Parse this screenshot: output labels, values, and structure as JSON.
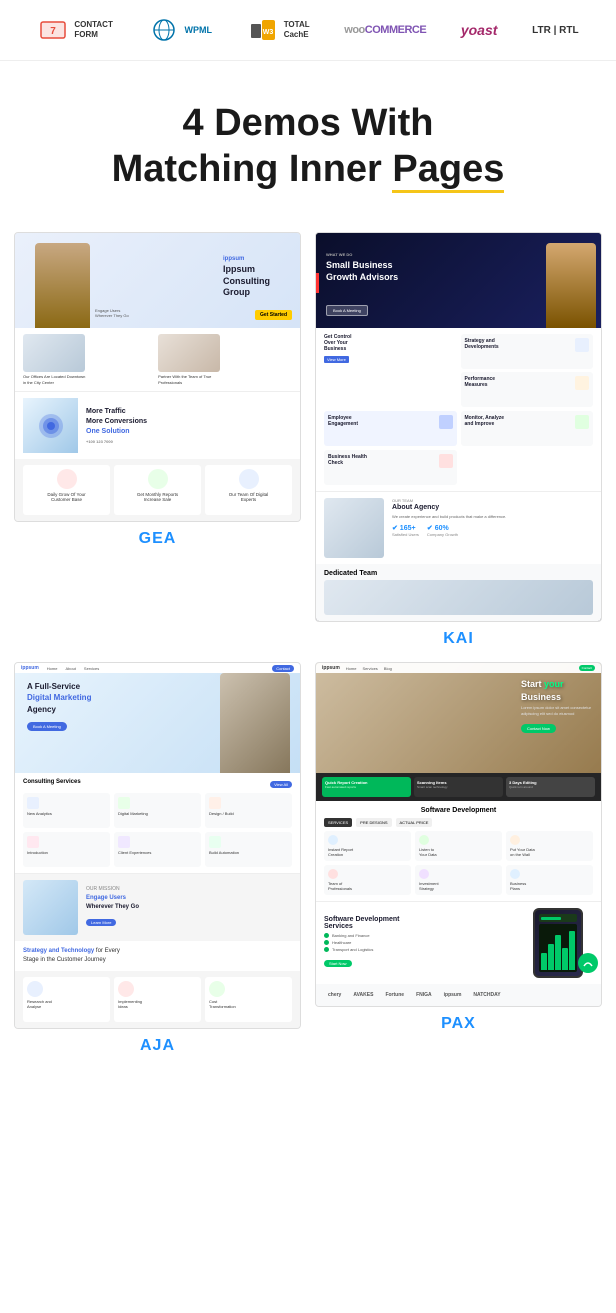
{
  "plugin_bar": {
    "plugins": [
      {
        "name": "contact-form-7",
        "label": "CONTACT\nFORM 7",
        "color": "#e74c3c"
      },
      {
        "name": "wpml",
        "label": "WPML",
        "color": "#0073aa"
      },
      {
        "name": "total-cache",
        "label": "TOTAL\nCACHE",
        "color": "#f0a500"
      },
      {
        "name": "woocommerce",
        "label": "WOO\nCOMMERCE",
        "color": "#7f54b3"
      },
      {
        "name": "yoast",
        "label": "yoast",
        "color": "#a4286a"
      },
      {
        "name": "ltr-rtl",
        "label": "LTR | RTL",
        "color": "#333"
      }
    ]
  },
  "hero": {
    "line1": "4 Demos With",
    "line2": "Matching Inner",
    "line2_underline": "Pages"
  },
  "demos": [
    {
      "id": "gea",
      "label": "GEA",
      "hero_text": "Ippsum\nConsulting\nGroup",
      "section2_left": "Our Offices Are Located Downtown\nin the City Center",
      "section2_right": "Partner With the Team of True\nProfessionals",
      "traffic_text": "More Traffic\nMore Conversions\nOne Solution",
      "bottom_items": [
        "Daily Grow Of Your\nCustomer Base",
        "Get Monthly Reports\nIncrease Sale",
        "Our Team Of Digital\nExperts"
      ]
    },
    {
      "id": "kai",
      "label": "KAI",
      "hero_text": "Small Business\nGrowth Advisors",
      "cards": [
        "Strategy and\nDevelopments",
        "Performance\nMeasures",
        "Employee\nEngagement",
        "Monitor, Analyze\nand Improve",
        "Business Health\nCheck"
      ],
      "about_text": "About Agency",
      "stats": [
        "165+",
        "60%"
      ],
      "stat_labels": [
        "Satisfied Users",
        "Company Growth"
      ],
      "team_text": "Dedicated Team"
    },
    {
      "id": "aja",
      "label": "AJA",
      "hero_text": "A Full-Service\nDigital Marketing\nAgency",
      "btn": "Book A Meeting",
      "services_title": "Consulting Services",
      "services": [
        "New Analytics",
        "Digital Marketing",
        "Design / Build",
        "Introduction",
        "Client Experiences",
        "Build Automation"
      ],
      "engage_text": "Engage Users\nWherever They Go",
      "strategy_text": "Strategy and Technology for Every\nStage in the Customer Journey",
      "bottom_items": [
        "Research and Analyse",
        "Implementing Ideas",
        "Cost Transformation"
      ]
    },
    {
      "id": "pax",
      "label": "PAX",
      "hero_text": "Start your\nBusiness",
      "btn": "Contact Now",
      "quick_items": [
        "Quick Report Creation",
        "Scanning Items",
        "3 Days Editing"
      ],
      "software_title": "Software Development",
      "tabs": [
        "SERVICES",
        "PRE DESIGNS",
        "ACTUAL PRICE"
      ],
      "services": [
        "Instant Report Creation",
        "Listen to Your Data",
        "Put Your Data on the Wall",
        "Team of Professionals",
        "Investment Strategy",
        "Business Plans"
      ],
      "dev_title": "Software Development\nServices",
      "dev_items": [
        "Banking and Finance",
        "Healthcare",
        "Transport and Logistics"
      ],
      "logos": [
        "chery",
        "AVAKES",
        "Fortune",
        "FNIGA",
        "ippsum",
        "NATCHDAY"
      ]
    }
  ]
}
